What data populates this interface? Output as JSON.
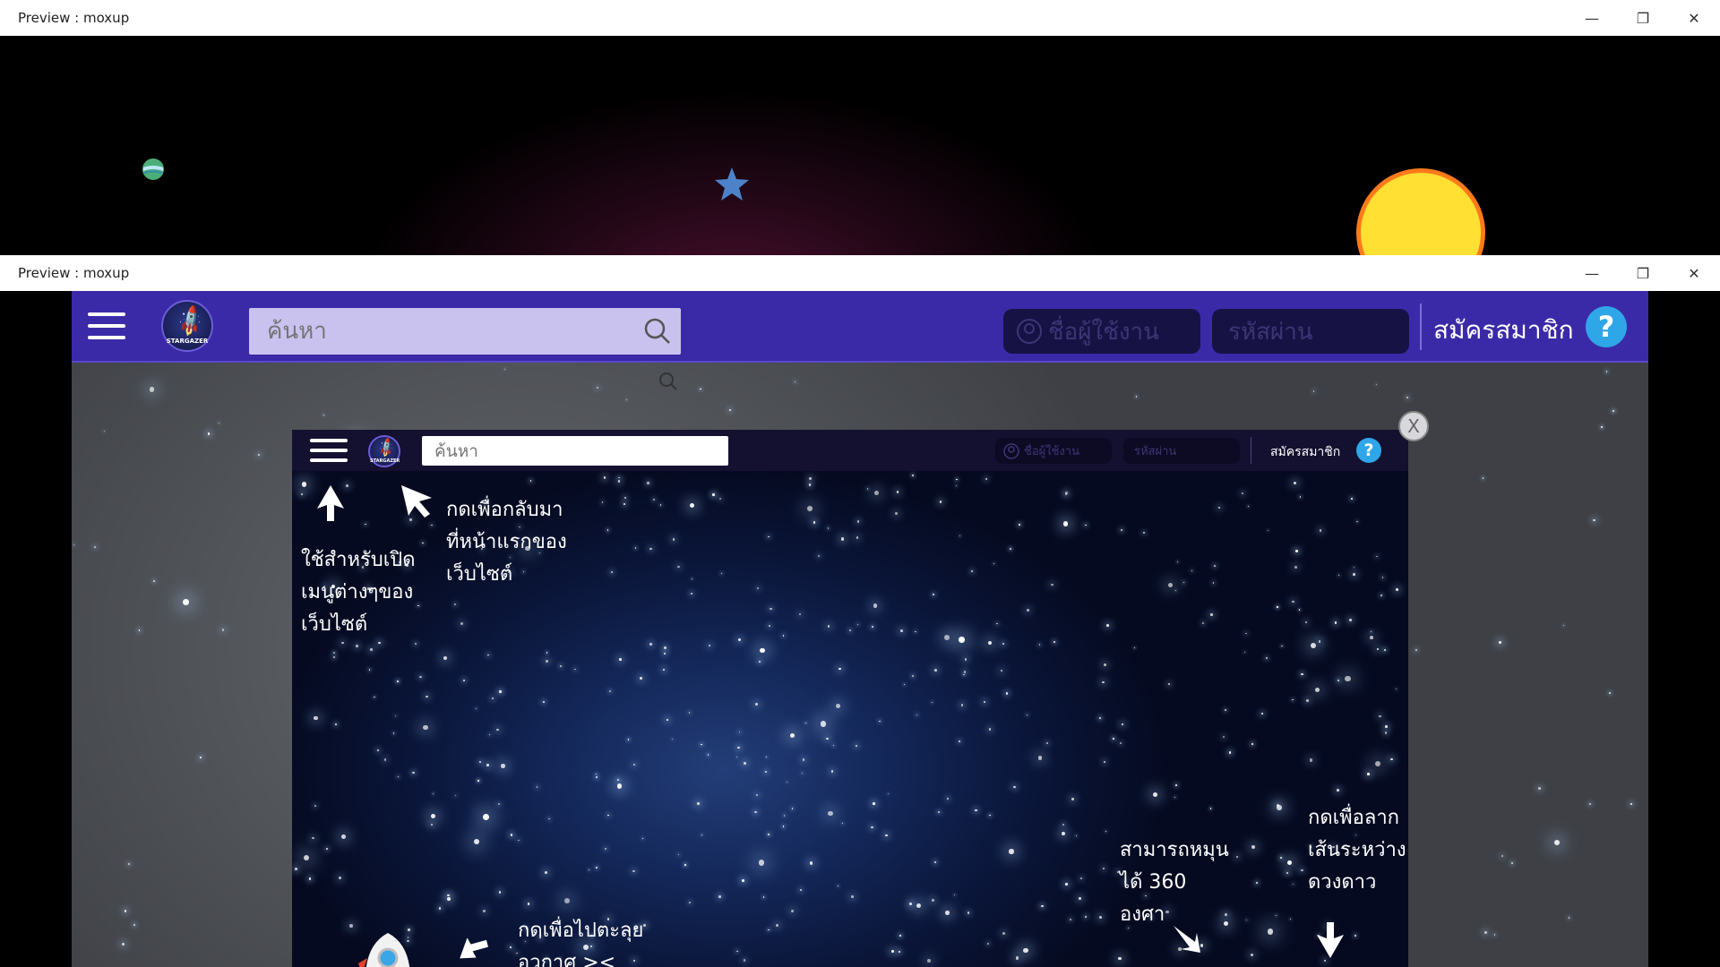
{
  "windows": {
    "top": {
      "title": "Preview : moxup"
    },
    "main": {
      "title": "Preview : moxup"
    }
  },
  "controls": {
    "minimize": "—",
    "restore": "❐",
    "close": "✕"
  },
  "outer_app": {
    "search": {
      "placeholder": "ค้นหา"
    },
    "logo_text": "STARGAZER",
    "username": {
      "placeholder": "ชื่อผู้ใช้งาน"
    },
    "password": {
      "placeholder": "รหัสผ่าน"
    },
    "signup_label": "สมัครสมาชิก",
    "help_label": "?"
  },
  "inner_app": {
    "search": {
      "placeholder": "ค้นหา"
    },
    "username": {
      "placeholder": "ชื่อผู้ใช้งาน"
    },
    "password": {
      "placeholder": "รหัสผ่าน"
    },
    "signup_label": "สมัครสมาชิก",
    "help_label": "?",
    "close_label": "X"
  },
  "annotations": {
    "menu": "ใช้สำหรับเปิด\nเมนูต่างๆของ\nเว็บไซต์",
    "home": "กดเพื่อกลับมา\nที่หน้าแรกของ\nเว็บไซต์",
    "launch": "กดเพื่อไปตะลุย\nอวกาศ ><",
    "rotate": "สามารถหมุน\nได้ 360\nองศา",
    "drag": "กดเพื่อลาก\nเส้นระหว่าง\nดวงดาว"
  },
  "colors": {
    "nav_purple": "#3b2aa8",
    "search_bg": "#c9c2ee",
    "help_blue": "#2fa6e8",
    "sun_yellow": "#ffe033",
    "sun_rays": "#ff7a1a"
  },
  "icons": [
    "minimize-icon",
    "restore-icon",
    "close-icon",
    "hamburger-icon",
    "rocket-icon",
    "search-icon",
    "user-icon",
    "help-icon",
    "planet-icon",
    "star-icon",
    "sun-icon",
    "arrow-icon"
  ]
}
